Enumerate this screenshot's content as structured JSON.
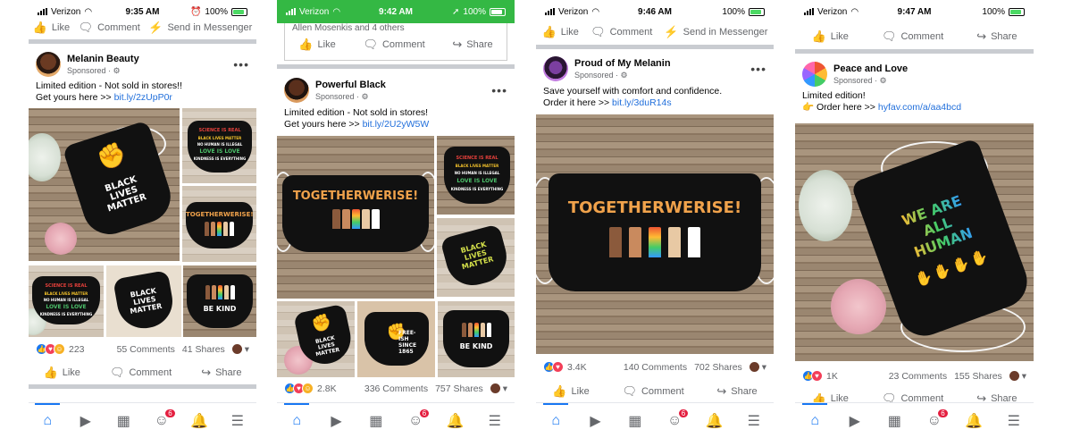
{
  "colors": {
    "facebook_blue": "#1877f2",
    "link": "#216fdb",
    "status_green": "#34b844",
    "badge_red": "#e41e3f"
  },
  "icons": {
    "like": "thumbs-up-icon",
    "comment": "comment-icon",
    "share": "share-icon",
    "messenger": "messenger-icon",
    "home": "home-icon",
    "watch": "video-icon",
    "marketplace": "store-icon",
    "groups": "groups-icon",
    "notifications": "bell-icon",
    "menu": "menu-icon"
  },
  "labels": {
    "like": "Like",
    "comment": "Comment",
    "share": "Share",
    "send_messenger": "Send in Messenger",
    "sponsored": "Sponsored ·",
    "more": "•••",
    "groups_badge": "6"
  },
  "mask_text": {
    "black_lives_matter": "BLACK LIVES MATTER",
    "science_is_real": "SCIENCE IS REAL",
    "sir_line2": "BLACK LIVES MATTER",
    "sir_line3": "NO HUMAN IS ILLEGAL",
    "sir_line4": "LOVE IS LOVE",
    "sir_line5": "KINDNESS IS EVERYTHING",
    "togetherwerise": "TOGETHERWERISE!",
    "be_kind": "BE KIND",
    "free_ish": "FREE-ISH SINCE 1865",
    "we_are_all_human": "WE ARE ALL HUMAN"
  },
  "screens": [
    {
      "carrier": "Verizon",
      "time": "9:35 AM",
      "battery": "100%",
      "top_actions": [
        "Like",
        "Comment",
        "Send in Messenger"
      ],
      "page_name": "Melanin Beauty",
      "text_line1": "Limited edition - Not sold in stores!!",
      "text_line2_prefix": "Get yours here >> ",
      "link": "bit.ly/2zUpP0r",
      "reaction_count": "223",
      "comments": "55 Comments",
      "shares": "41 Shares"
    },
    {
      "carrier": "Verizon",
      "time": "9:42 AM",
      "battery": "100%",
      "prev_text": "Allen Mosenkis and 4 others",
      "page_name": "Powerful Black",
      "text_line1": "Limited edition - Not sold in stores!",
      "text_line2_prefix": "Get yours here >> ",
      "link": "bit.ly/2U2yW5W",
      "reaction_count": "2.8K",
      "comments": "336 Comments",
      "shares": "757 Shares"
    },
    {
      "carrier": "Verizon",
      "time": "9:46 AM",
      "battery": "100%",
      "top_actions": [
        "Like",
        "Comment",
        "Send in Messenger"
      ],
      "page_name": "Proud of My Melanin",
      "text_line1": "Save yourself with comfort and confidence.",
      "text_line2_prefix": "Order it here >> ",
      "link": "bit.ly/3duR14s",
      "reaction_count": "3.4K",
      "comments": "140 Comments",
      "shares": "702 Shares"
    },
    {
      "carrier": "Verizon",
      "time": "9:47 AM",
      "battery": "100%",
      "top_actions": [
        "Like",
        "Comment",
        "Share"
      ],
      "page_name": "Peace and Love",
      "text_line1": "Limited edition!",
      "text_line2_prefix": "👉 Order here >> ",
      "link": "hyfav.com/a/aa4bcd",
      "reaction_count": "1K",
      "comments": "23 Comments",
      "shares": "155 Shares"
    }
  ]
}
